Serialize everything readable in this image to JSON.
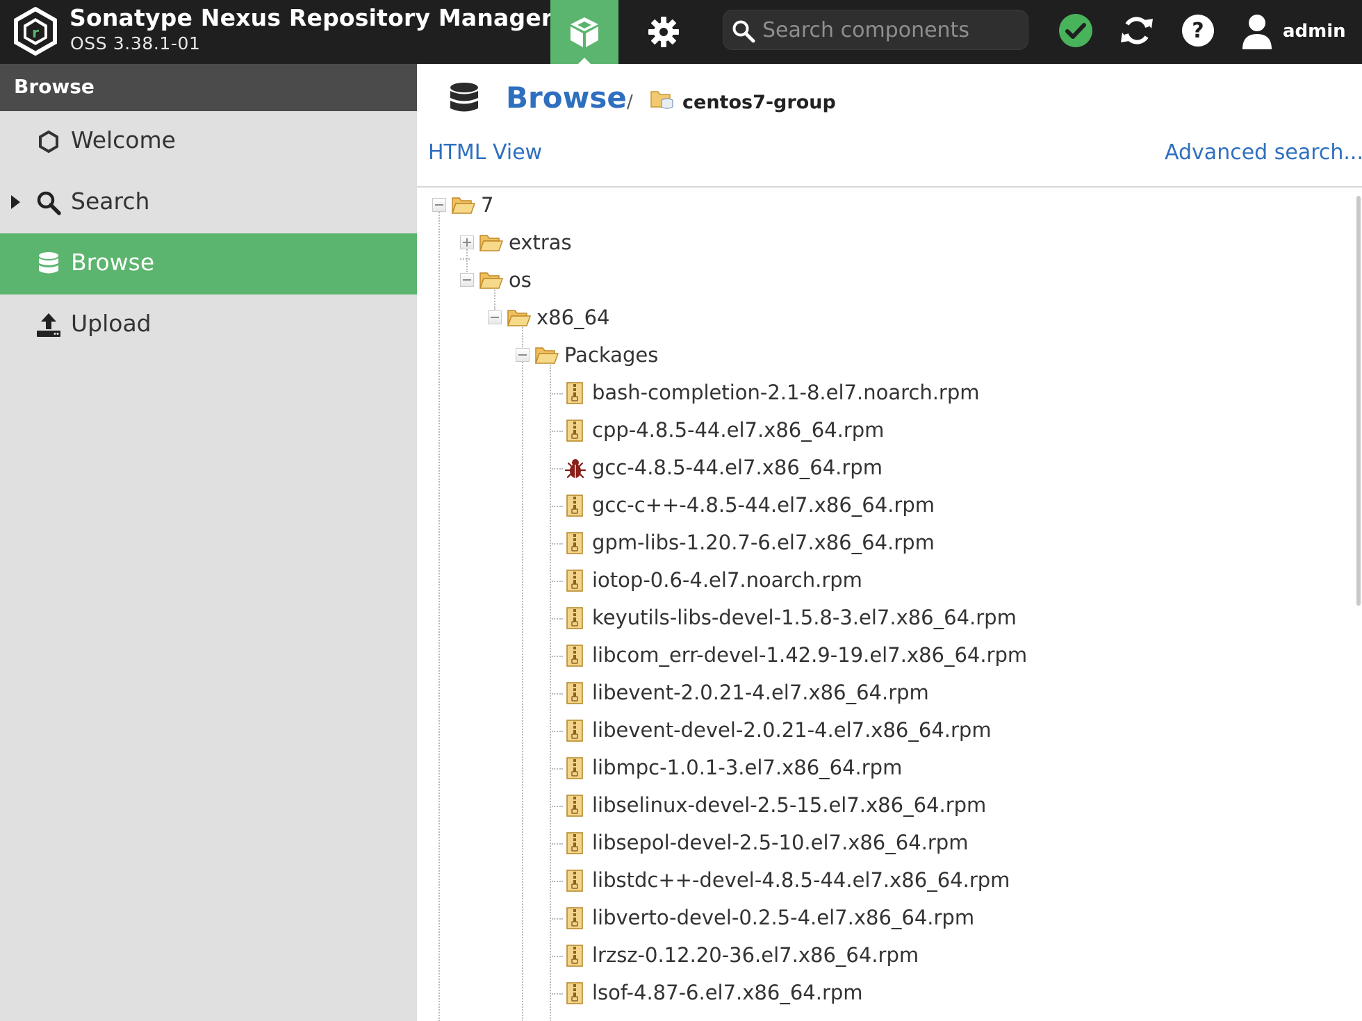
{
  "app": {
    "title": "Sonatype Nexus Repository Manager",
    "version": "OSS 3.38.1-01",
    "search_placeholder": "Search components",
    "user": "admin",
    "colors": {
      "header": "#1f1f1f",
      "accent_green": "#5bb56e",
      "link_blue": "#2f6fbf",
      "sidebar": "#e0e0e0"
    }
  },
  "sidebar": {
    "header": "Browse",
    "items": [
      {
        "label": "Welcome",
        "icon": "hexagon-icon",
        "active": false,
        "expandable": false
      },
      {
        "label": "Search",
        "icon": "search-icon",
        "active": false,
        "expandable": true
      },
      {
        "label": "Browse",
        "icon": "database-icon",
        "active": true,
        "expandable": false
      },
      {
        "label": "Upload",
        "icon": "upload-icon",
        "active": false,
        "expandable": false
      }
    ]
  },
  "main": {
    "breadcrumb": {
      "title": "Browse",
      "separator": "/",
      "repository": "centos7-group"
    },
    "toolbar": {
      "html_view": "HTML View",
      "advanced_search": "Advanced search..."
    },
    "tree": {
      "root": "7",
      "extras": "extras",
      "os": "os",
      "arch": "x86_64",
      "packages": "Packages",
      "files": [
        {
          "name": "bash-completion-2.1-8.el7.noarch.rpm",
          "icon": "rpm-file-icon"
        },
        {
          "name": "cpp-4.8.5-44.el7.x86_64.rpm",
          "icon": "rpm-file-icon"
        },
        {
          "name": "gcc-4.8.5-44.el7.x86_64.rpm",
          "icon": "bug-icon"
        },
        {
          "name": "gcc-c++-4.8.5-44.el7.x86_64.rpm",
          "icon": "rpm-file-icon"
        },
        {
          "name": "gpm-libs-1.20.7-6.el7.x86_64.rpm",
          "icon": "rpm-file-icon"
        },
        {
          "name": "iotop-0.6-4.el7.noarch.rpm",
          "icon": "rpm-file-icon"
        },
        {
          "name": "keyutils-libs-devel-1.5.8-3.el7.x86_64.rpm",
          "icon": "rpm-file-icon"
        },
        {
          "name": "libcom_err-devel-1.42.9-19.el7.x86_64.rpm",
          "icon": "rpm-file-icon"
        },
        {
          "name": "libevent-2.0.21-4.el7.x86_64.rpm",
          "icon": "rpm-file-icon"
        },
        {
          "name": "libevent-devel-2.0.21-4.el7.x86_64.rpm",
          "icon": "rpm-file-icon"
        },
        {
          "name": "libmpc-1.0.1-3.el7.x86_64.rpm",
          "icon": "rpm-file-icon"
        },
        {
          "name": "libselinux-devel-2.5-15.el7.x86_64.rpm",
          "icon": "rpm-file-icon"
        },
        {
          "name": "libsepol-devel-2.5-10.el7.x86_64.rpm",
          "icon": "rpm-file-icon"
        },
        {
          "name": "libstdc++-devel-4.8.5-44.el7.x86_64.rpm",
          "icon": "rpm-file-icon"
        },
        {
          "name": "libverto-devel-0.2.5-4.el7.x86_64.rpm",
          "icon": "rpm-file-icon"
        },
        {
          "name": "lrzsz-0.12.20-36.el7.x86_64.rpm",
          "icon": "rpm-file-icon"
        },
        {
          "name": "lsof-4.87-6.el7.x86_64.rpm",
          "icon": "rpm-file-icon"
        }
      ]
    }
  }
}
